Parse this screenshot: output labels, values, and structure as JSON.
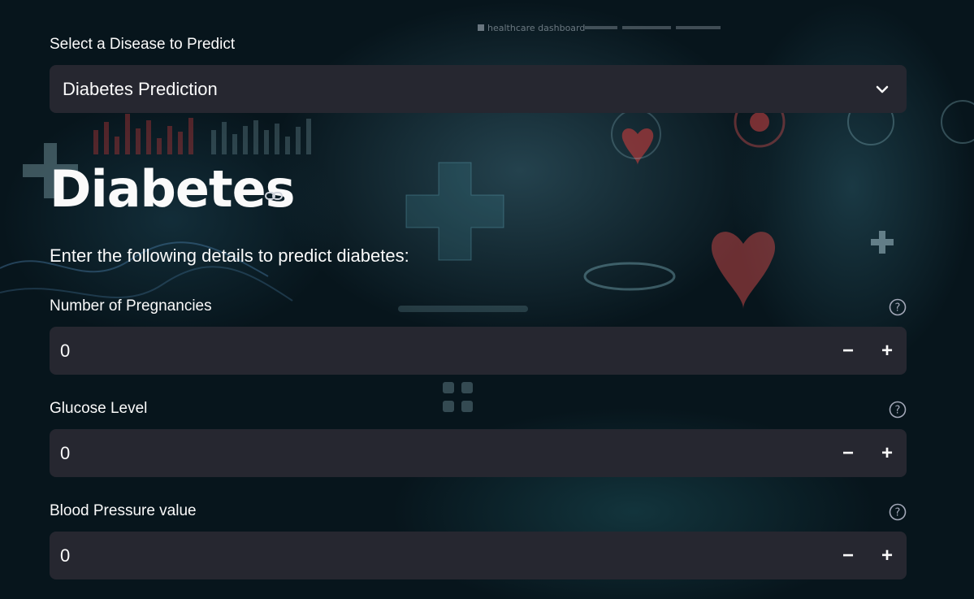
{
  "disease_select": {
    "label": "Select a Disease to Predict",
    "value": "Diabetes Prediction"
  },
  "page": {
    "title": "Diabetes",
    "description": "Enter the following details to predict diabetes:"
  },
  "background": {
    "header_text": "healthcare dashboard"
  },
  "fields": [
    {
      "label": "Number of Pregnancies",
      "value": "0",
      "minus": "−",
      "plus": "+"
    },
    {
      "label": "Glucose Level",
      "value": "0",
      "minus": "−",
      "plus": "+"
    },
    {
      "label": "Blood Pressure value",
      "value": "0",
      "minus": "−",
      "plus": "+"
    }
  ],
  "icons": {
    "select": "chevron-down-icon",
    "title": "link-icon",
    "help": "help-circle-icon"
  },
  "colors": {
    "widget_bg": "#262730",
    "text": "#fafafa",
    "muted": "#a3a8b8"
  }
}
